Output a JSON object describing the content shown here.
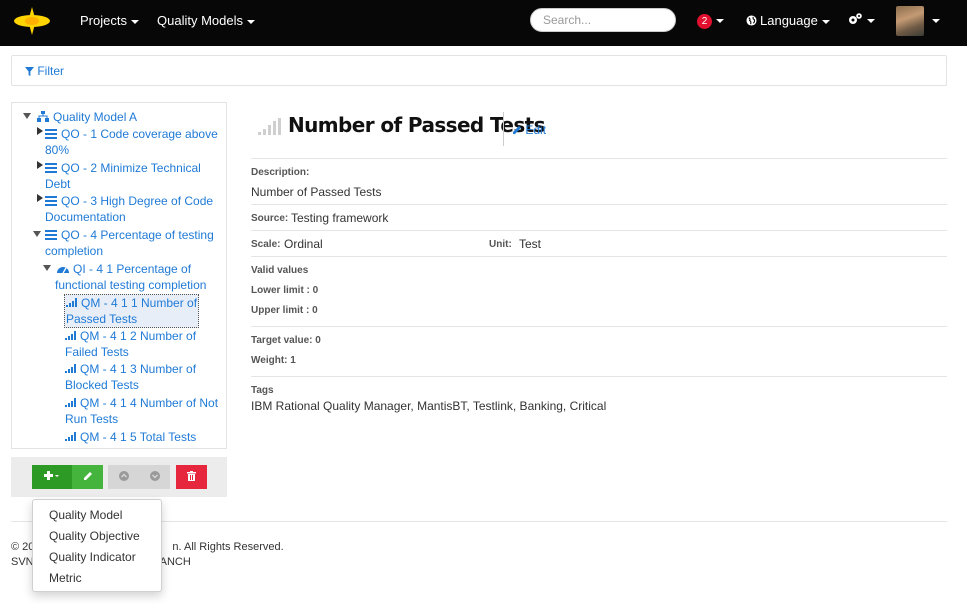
{
  "nav": {
    "projects": "Projects",
    "quality_models": "Quality Models",
    "search_placeholder": "Search...",
    "notification_count": "2",
    "language": "Language"
  },
  "filter": {
    "label": "Filter"
  },
  "tree": {
    "root": "Quality Model A",
    "qo1": "QO - 1 Code coverage above",
    "qo1_cont": "80%",
    "qo2": "QO - 2 Minimize Technical",
    "qo2_cont": "Debt",
    "qo3": "QO - 3 High Degree of Code",
    "qo3_cont": "Documentation",
    "qo4": "QO - 4 Percentage of testing",
    "qo4_cont": "completion",
    "qi41": "QI - 4 1 Percentage of",
    "qi41_cont": "functional testing completion",
    "qm411": "QM - 4 1 1 Number of",
    "qm411_cont": "Passed Tests",
    "qm412": "QM - 4 1 2 Number of",
    "qm412_cont": "Failed Tests",
    "qm413": "QM - 4 1 3 Number of",
    "qm413_cont": "Blocked Tests",
    "qm414": "QM - 4 1 4 Number of Not",
    "qm414_cont": "Run Tests",
    "qm415": "QM - 4 1 5 Total Tests"
  },
  "dropdown": {
    "items": [
      "Quality Model",
      "Quality Objective",
      "Quality Indicator",
      "Metric"
    ]
  },
  "detail": {
    "title": "Number of Passed Tests",
    "edit": "Edit",
    "description_label": "Description:",
    "description": "Number of Passed Tests",
    "source_label": "Source:",
    "source": "Testing framework",
    "scale_label": "Scale:",
    "scale": "Ordinal",
    "unit_label": "Unit:",
    "unit": "Test",
    "valid_values_label": "Valid values",
    "lower_limit": "Lower limit : 0",
    "upper_limit": "Upper limit : 0",
    "target_value": "Target value: 0",
    "weight": "Weight: 1",
    "tags_label": "Tags",
    "tags": "IBM Rational Quality Manager, MantisBT, Testlink, Banking, Critical"
  },
  "footer": {
    "line1_start": "© 20",
    "line1_end": "n. All Rights Reserved.",
    "line2_start": "SVN",
    "line2_end": "ANCH"
  },
  "colors": {
    "navbar": "#070707",
    "link": "#1f7ad6",
    "add_green": "#2e9a26",
    "delete_red": "#e6263c",
    "badge_red": "#e0102e"
  }
}
